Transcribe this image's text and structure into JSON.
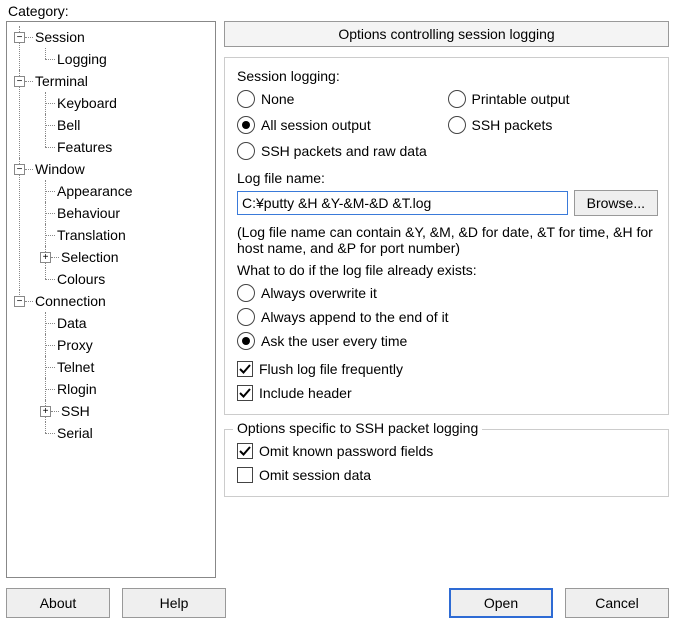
{
  "category_label": "Category:",
  "tree": {
    "session": "Session",
    "logging": "Logging",
    "terminal": "Terminal",
    "keyboard": "Keyboard",
    "bell": "Bell",
    "features": "Features",
    "window": "Window",
    "appearance": "Appearance",
    "behaviour": "Behaviour",
    "translation": "Translation",
    "selection": "Selection",
    "colours": "Colours",
    "connection": "Connection",
    "data": "Data",
    "proxy": "Proxy",
    "telnet": "Telnet",
    "rlogin": "Rlogin",
    "ssh": "SSH",
    "serial": "Serial"
  },
  "header": "Options controlling session logging",
  "session_logging_label": "Session logging:",
  "radios1": {
    "none": "None",
    "printable": "Printable output",
    "all": "All session output",
    "sshpkt": "SSH packets",
    "sshraw": "SSH packets and raw data",
    "selected": "all"
  },
  "logfile": {
    "label": "Log file name:",
    "value": "C:¥putty &H &Y-&M-&D &T.log",
    "browse": "Browse...",
    "hint": "(Log file name can contain &Y, &M, &D for date, &T for time, &H for host name, and &P for port number)"
  },
  "exists": {
    "label": "What to do if the log file already exists:",
    "overwrite": "Always overwrite it",
    "append": "Always append to the end of it",
    "ask": "Ask the user every time",
    "selected": "ask"
  },
  "checks": {
    "flush": {
      "label": "Flush log file frequently",
      "checked": true
    },
    "header": {
      "label": "Include header",
      "checked": true
    }
  },
  "sshbox": {
    "title": "Options specific to SSH packet logging",
    "omit_pw": {
      "label": "Omit known password fields",
      "checked": true
    },
    "omit_data": {
      "label": "Omit session data",
      "checked": false
    }
  },
  "buttons": {
    "about": "About",
    "help": "Help",
    "open": "Open",
    "cancel": "Cancel"
  }
}
